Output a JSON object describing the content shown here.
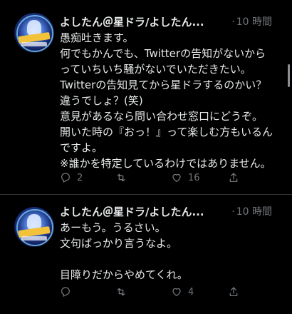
{
  "tweets": [
    {
      "author_display": "よしたん＠星ドラ/よしたん...",
      "time": "10 時間",
      "lines": [
        "愚痴吐きます。",
        "何でもかんでも、Twitterの告知がないから",
        "っていちいち騒がないでいただきたい。",
        "Twitterの告知見てから星ドラするのかい？",
        "違うでしょ？(笑)",
        "意見があるなら問い合わせ窓口にどうぞ。",
        "開いた時の『おっ！』って楽しむ方もいるん",
        "ですよ。",
        "※誰かを特定しているわけではありません。"
      ],
      "reply_count": "2",
      "retweet_count": "",
      "like_count": "16"
    },
    {
      "author_display": "よしたん＠星ドラ/よしたん...",
      "time": "10 時間",
      "lines": [
        "あーもう。うるさい。",
        "文句ばっかり言うなよ。",
        "",
        "目障りだからやめてくれ。"
      ],
      "reply_count": "",
      "retweet_count": "",
      "like_count": "4"
    }
  ],
  "icons": [
    "reply-icon",
    "retweet-icon",
    "like-icon",
    "share-icon"
  ],
  "colors": {
    "background": "#000000",
    "text": "#e7e9ea",
    "secondary": "#71767b",
    "divider": "#2f3336"
  }
}
